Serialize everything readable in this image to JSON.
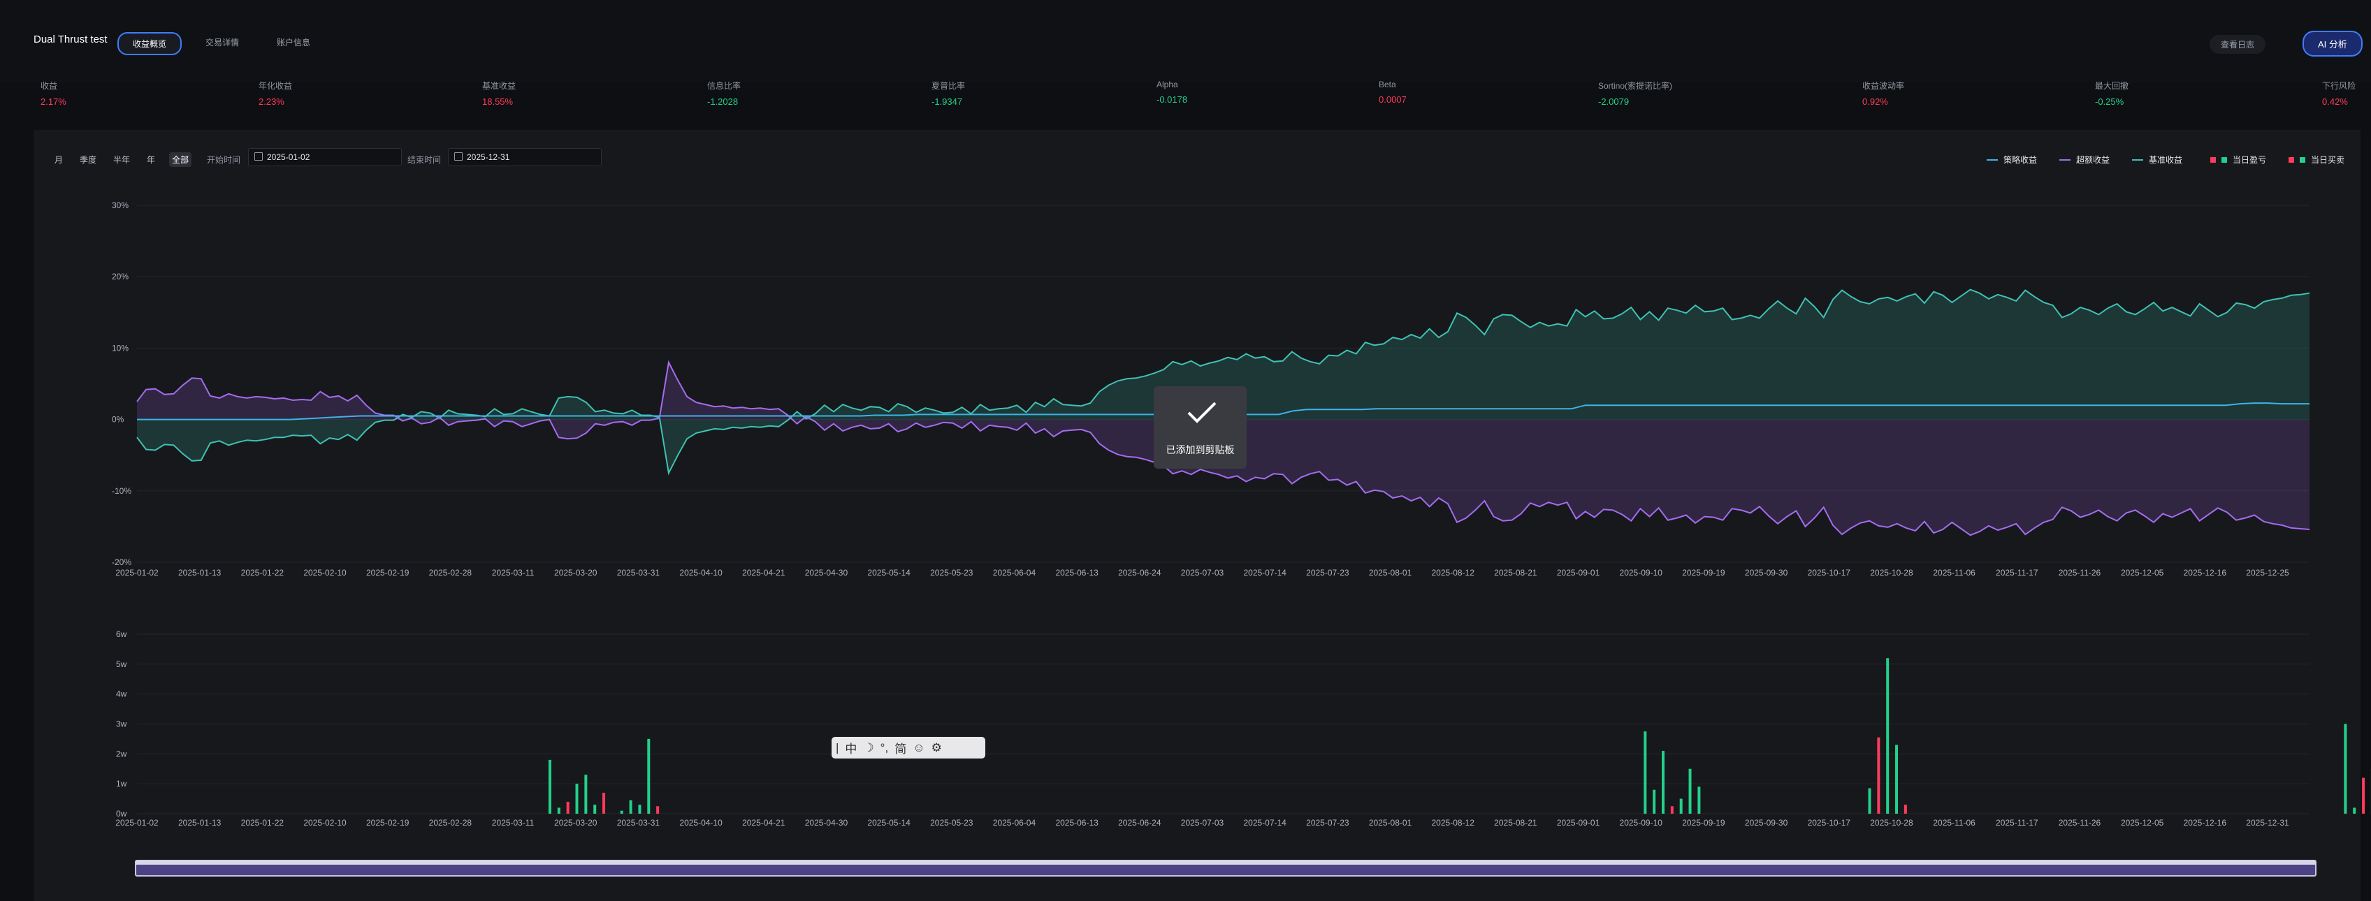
{
  "app_title": "Dual Thrust test",
  "tabs": [
    {
      "label": "收益概览",
      "active": true
    },
    {
      "label": "交易详情",
      "active": false
    },
    {
      "label": "账户信息",
      "active": false
    }
  ],
  "header_buttons": {
    "log": "查看日志",
    "ai": "分析",
    "ai_icon": "AI"
  },
  "metrics": [
    {
      "label": "收益",
      "value": "2.17%",
      "color": "#ff3b5c"
    },
    {
      "label": "年化收益",
      "value": "2.23%",
      "color": "#ff3b5c"
    },
    {
      "label": "基准收益",
      "value": "18.55%",
      "color": "#ff3b5c"
    },
    {
      "label": "信息比率",
      "value": "-1.2028",
      "color": "#23d18b"
    },
    {
      "label": "夏普比率",
      "value": "-1.9347",
      "color": "#23d18b"
    },
    {
      "label": "Alpha",
      "value": "-0.0178",
      "color": "#23d18b"
    },
    {
      "label": "Beta",
      "value": "0.0007",
      "color": "#ff3b5c"
    },
    {
      "label": "Sortino(索提诺比率)",
      "value": "-2.0079",
      "color": "#23d18b"
    },
    {
      "label": "收益波动率",
      "value": "0.92%",
      "color": "#ff3b5c"
    },
    {
      "label": "最大回撤",
      "value": "-0.25%",
      "color": "#23d18b"
    },
    {
      "label": "下行风险",
      "value": "0.42%",
      "color": "#ff3b5c"
    }
  ],
  "periods": [
    {
      "label": "月",
      "active": false
    },
    {
      "label": "季度",
      "active": false
    },
    {
      "label": "半年",
      "active": false
    },
    {
      "label": "年",
      "active": false
    },
    {
      "label": "全部",
      "active": true
    }
  ],
  "date_range": {
    "start_label": "开始时间",
    "start": "2025-01-02",
    "end_label": "结束时间",
    "end": "2025-12-31"
  },
  "legend": [
    {
      "label": "策略收益",
      "kind": "line",
      "color": "#3db4e6"
    },
    {
      "label": "超额收益",
      "kind": "line",
      "color": "#a56cf0"
    },
    {
      "label": "基准收益",
      "kind": "line",
      "color": "#3ec2b3"
    },
    {
      "label": "当日盈亏",
      "kind": "square",
      "color": "#ff3b5c",
      "color2": "#23d18b"
    },
    {
      "label": "当日买卖",
      "kind": "square",
      "color": "#ff3b5c",
      "color2": "#23d18b"
    }
  ],
  "toast": {
    "text": "已添加到剪贴板",
    "icon": "check-icon"
  },
  "ime": [
    "|",
    "中",
    "☽",
    "°,",
    "简",
    "☺",
    "⚙"
  ],
  "chart_data": [
    {
      "type": "area",
      "x_ticks": [
        "2025-01-02",
        "2025-01-13",
        "2025-01-22",
        "2025-02-10",
        "2025-02-19",
        "2025-02-28",
        "2025-03-11",
        "2025-03-20",
        "2025-03-31",
        "2025-04-10",
        "2025-04-21",
        "2025-04-30",
        "2025-05-14",
        "2025-05-23",
        "2025-06-04",
        "2025-06-13",
        "2025-06-24",
        "2025-07-03",
        "2025-07-14",
        "2025-07-23",
        "2025-08-01",
        "2025-08-12",
        "2025-08-21",
        "2025-09-01",
        "2025-09-10",
        "2025-09-19",
        "2025-09-30",
        "2025-10-17",
        "2025-10-28",
        "2025-11-06",
        "2025-11-17",
        "2025-11-26",
        "2025-12-05",
        "2025-12-16",
        "2025-12-25"
      ],
      "y_ticks": [
        "30%",
        "20%",
        "10%",
        "0%",
        "-10%",
        "-20%"
      ],
      "ylim": [
        -20,
        30
      ],
      "series": [
        {
          "name": "策略收益",
          "color": "#3db4e6",
          "values": [
            0,
            0,
            0,
            0,
            0,
            0,
            0,
            0,
            0,
            0,
            0,
            0,
            0.1,
            0.2,
            0.3,
            0.4,
            0.5,
            0.5,
            0.5,
            0.5,
            0.5,
            0.5,
            0.5,
            0.5,
            0.5,
            0.5,
            0.5,
            0.5,
            0.5,
            0.5,
            0.5,
            0.5,
            0.5,
            0.5,
            0.5,
            0.5,
            0.5,
            0.5,
            0.5,
            0.5,
            0.5,
            0.5,
            0.5,
            0.5,
            0.5,
            0.5,
            0.5,
            0.5,
            0.5,
            0.5,
            0.5,
            0.5,
            0.5,
            0.6,
            0.6,
            0.6,
            0.7,
            0.7,
            0.7,
            0.7,
            0.7,
            0.7,
            0.7,
            0.7,
            0.7,
            0.7,
            0.7,
            0.7,
            0.7,
            0.7,
            0.7,
            0.7,
            0.7,
            0.7,
            0.7,
            0.7,
            0.7,
            0.7,
            0.7,
            0.7,
            0.7,
            0.7,
            0.7,
            1.2,
            1.4,
            1.4,
            1.4,
            1.4,
            1.4,
            1.5,
            1.5,
            1.5,
            1.5,
            1.5,
            1.5,
            1.5,
            1.5,
            1.5,
            1.5,
            1.5,
            1.5,
            1.5,
            1.5,
            1.5,
            2.0,
            2.0,
            2.0,
            2.0,
            2.0,
            2.0,
            2.0,
            2.0,
            2.0,
            2.0,
            2.0,
            2.0,
            2.0,
            2.0,
            2.0,
            2.0,
            2.0,
            2.0,
            2.0,
            2.0,
            2.0,
            2.0,
            2.0,
            2.0,
            2.0,
            2.0,
            2.0,
            2.0,
            2.0,
            2.0,
            2.0,
            2.0,
            2.0,
            2.0,
            2.0,
            2.0,
            2.0,
            2.0,
            2.0,
            2.0,
            2.0,
            2.0,
            2.0,
            2.0,
            2.0,
            2.0,
            2.0,
            2.2,
            2.3,
            2.3,
            2.2,
            2.2,
            2.2
          ]
        },
        {
          "name": "超额收益",
          "color": "#a56cf0",
          "values": [
            2.5,
            4.2,
            4.3,
            3.5,
            3.6,
            4.8,
            5.8,
            5.7,
            3.3,
            3.0,
            3.6,
            3.2,
            3.0,
            3.2,
            3.1,
            2.9,
            3.0,
            2.7,
            2.8,
            2.7,
            3.9,
            3.1,
            3.3,
            2.6,
            3.4,
            2.0,
            0.9,
            0.6,
            0.6,
            -0.2,
            0.2,
            -0.6,
            -0.4,
            0.3,
            -0.8,
            -0.3,
            -0.2,
            -0.1,
            0.1,
            -1.0,
            -0.2,
            -0.3,
            -1.0,
            -0.6,
            -0.2,
            0.0,
            -2.5,
            -2.7,
            -2.6,
            -1.9,
            -0.6,
            -0.8,
            -0.4,
            -0.3,
            -0.8,
            -0.1,
            -0.1,
            0.2,
            8.0,
            5.5,
            3.2,
            2.4,
            2.1,
            1.8,
            1.9,
            1.6,
            1.7,
            1.5,
            1.6,
            1.4,
            1.5,
            0.6,
            -0.6,
            0.4,
            -0.3,
            -1.5,
            -0.6,
            -1.6,
            -1.1,
            -0.8,
            -1.3,
            -1.2,
            -0.6,
            -1.7,
            -1.3,
            -0.5,
            -1.1,
            -0.8,
            -0.4,
            -0.5,
            -1.2,
            -0.3,
            -1.6,
            -0.8,
            -1.0,
            -1.1,
            -1.5,
            -0.5,
            -1.9,
            -1.3,
            -2.4,
            -1.6,
            -1.5,
            -1.4,
            -1.8,
            -3.4,
            -4.3,
            -4.9,
            -5.2,
            -5.3,
            -5.6,
            -6.0,
            -6.5,
            -7.6,
            -7.2,
            -7.7,
            -7.0,
            -7.4,
            -7.7,
            -8.2,
            -7.9,
            -8.7,
            -8.1,
            -8.3,
            -7.6,
            -7.7,
            -9.0,
            -8.1,
            -7.6,
            -7.3,
            -8.5,
            -8.4,
            -9.2,
            -8.7,
            -10.3,
            -9.9,
            -10.1,
            -11.0,
            -10.7,
            -11.4,
            -10.9,
            -12.2,
            -11.0,
            -11.8,
            -14.4,
            -13.8,
            -12.7,
            -11.4,
            -13.6,
            -14.2,
            -14.1,
            -13.2,
            -11.7,
            -12.2,
            -11.6,
            -12.0,
            -11.6,
            -13.9,
            -12.9,
            -13.7,
            -12.6,
            -12.7,
            -13.3,
            -14.2,
            -12.5,
            -13.6,
            -12.4,
            -14.1,
            -13.8,
            -13.4,
            -14.5,
            -13.6,
            -13.7,
            -14.1,
            -12.5,
            -12.7,
            -13.1,
            -12.2,
            -13.5,
            -14.6,
            -13.6,
            -12.8,
            -15.0,
            -13.8,
            -12.3,
            -14.8,
            -16.1,
            -15.2,
            -14.5,
            -14.2,
            -14.9,
            -15.1,
            -14.6,
            -15.2,
            -15.6,
            -14.3,
            -15.9,
            -15.4,
            -14.4,
            -15.3,
            -16.2,
            -15.7,
            -14.9,
            -15.5,
            -15.1,
            -14.6,
            -16.1,
            -15.2,
            -14.4,
            -14.0,
            -12.3,
            -12.8,
            -13.7,
            -13.3,
            -12.7,
            -13.6,
            -14.2,
            -13.1,
            -12.7,
            -13.5,
            -14.4,
            -13.2,
            -13.7,
            -13.1,
            -12.5,
            -14.2,
            -13.3,
            -12.4,
            -13.0,
            -14.1,
            -13.8,
            -13.4,
            -14.3,
            -14.6,
            -14.8,
            -15.2,
            -15.3,
            -15.4
          ]
        },
        {
          "name": "基准收益",
          "color": "#3ec2b3",
          "values": [
            -2.5,
            -4.2,
            -4.3,
            -3.5,
            -3.6,
            -4.8,
            -5.8,
            -5.7,
            -3.3,
            -3.0,
            -3.6,
            -3.2,
            -2.9,
            -3.0,
            -2.8,
            -2.5,
            -2.5,
            -2.2,
            -2.3,
            -2.2,
            -3.4,
            -2.6,
            -2.8,
            -2.1,
            -2.9,
            -1.5,
            -0.4,
            -0.1,
            -0.1,
            0.7,
            0.3,
            1.1,
            0.9,
            0.2,
            1.3,
            0.8,
            0.7,
            0.6,
            0.4,
            1.5,
            0.7,
            0.8,
            1.5,
            1.1,
            0.7,
            0.5,
            3.0,
            3.2,
            3.1,
            2.4,
            1.1,
            1.3,
            0.9,
            0.8,
            1.3,
            0.6,
            0.6,
            0.3,
            -7.5,
            -5.0,
            -2.7,
            -1.9,
            -1.6,
            -1.3,
            -1.4,
            -1.1,
            -1.2,
            -1.0,
            -1.1,
            -0.9,
            -1.0,
            -0.1,
            1.1,
            0.1,
            0.8,
            2.0,
            1.1,
            2.1,
            1.6,
            1.3,
            1.8,
            1.7,
            1.1,
            2.2,
            1.8,
            1.0,
            1.6,
            1.3,
            0.9,
            1.0,
            1.7,
            0.8,
            2.1,
            1.3,
            1.5,
            1.6,
            2.0,
            1.0,
            2.4,
            1.8,
            2.9,
            2.1,
            2.0,
            1.9,
            2.3,
            3.9,
            4.8,
            5.4,
            5.7,
            5.8,
            6.1,
            6.5,
            7.0,
            8.1,
            7.7,
            8.2,
            7.5,
            7.9,
            8.2,
            8.7,
            8.4,
            9.2,
            8.6,
            8.8,
            8.1,
            8.2,
            9.5,
            8.6,
            8.1,
            7.8,
            9.0,
            8.9,
            9.7,
            9.2,
            10.8,
            10.4,
            10.6,
            11.5,
            11.2,
            11.9,
            11.4,
            12.7,
            11.5,
            12.3,
            14.9,
            14.3,
            13.2,
            11.9,
            14.1,
            14.7,
            14.6,
            13.7,
            12.9,
            13.6,
            13.1,
            13.4,
            13.1,
            15.4,
            14.4,
            15.2,
            14.1,
            14.2,
            14.8,
            15.7,
            14.0,
            15.1,
            13.9,
            15.6,
            15.3,
            14.9,
            16.0,
            15.1,
            15.2,
            15.6,
            14.0,
            14.2,
            14.6,
            14.2,
            15.5,
            16.6,
            15.6,
            14.8,
            17.0,
            15.8,
            14.3,
            16.8,
            18.1,
            17.2,
            16.5,
            16.2,
            16.9,
            17.1,
            16.6,
            17.2,
            17.6,
            16.3,
            17.9,
            17.4,
            16.4,
            17.3,
            18.2,
            17.7,
            16.9,
            17.5,
            17.1,
            16.6,
            18.1,
            17.2,
            16.4,
            16.0,
            14.3,
            14.8,
            15.7,
            15.3,
            14.7,
            15.6,
            16.2,
            15.1,
            14.7,
            15.5,
            16.4,
            15.2,
            15.7,
            15.1,
            14.5,
            16.2,
            15.3,
            14.4,
            15.0,
            16.3,
            16.1,
            15.6,
            16.5,
            16.8,
            17.0,
            17.4,
            17.5,
            17.7
          ]
        }
      ]
    },
    {
      "type": "bar",
      "x_ticks": [
        "2025-01-02",
        "2025-01-13",
        "2025-01-22",
        "2025-02-10",
        "2025-02-19",
        "2025-02-28",
        "2025-03-11",
        "2025-03-20",
        "2025-03-31",
        "2025-04-10",
        "2025-04-21",
        "2025-04-30",
        "2025-05-14",
        "2025-05-23",
        "2025-06-04",
        "2025-06-13",
        "2025-06-24",
        "2025-07-03",
        "2025-07-14",
        "2025-07-23",
        "2025-08-01",
        "2025-08-12",
        "2025-08-21",
        "2025-09-01",
        "2025-09-10",
        "2025-09-19",
        "2025-09-30",
        "2025-10-17",
        "2025-10-28",
        "2025-11-06",
        "2025-11-17",
        "2025-11-26",
        "2025-12-05",
        "2025-12-16",
        "2025-12-31"
      ],
      "y_ticks": [
        "6w",
        "5w",
        "4w",
        "3w",
        "2w",
        "1w",
        "0w"
      ],
      "ylim": [
        0,
        60000
      ],
      "bars": [
        {
          "idx": 46,
          "value": 18000,
          "color": "#23d18b"
        },
        {
          "idx": 47,
          "value": 2000,
          "color": "#23d18b"
        },
        {
          "idx": 48,
          "value": 4000,
          "color": "#ff3b5c"
        },
        {
          "idx": 49,
          "value": 10000,
          "color": "#23d18b"
        },
        {
          "idx": 50,
          "value": 13000,
          "color": "#23d18b"
        },
        {
          "idx": 51,
          "value": 3000,
          "color": "#23d18b"
        },
        {
          "idx": 52,
          "value": 7000,
          "color": "#ff3b5c"
        },
        {
          "idx": 54,
          "value": 1000,
          "color": "#23d18b"
        },
        {
          "idx": 55,
          "value": 4500,
          "color": "#23d18b"
        },
        {
          "idx": 56,
          "value": 3000,
          "color": "#23d18b"
        },
        {
          "idx": 57,
          "value": 25000,
          "color": "#23d18b"
        },
        {
          "idx": 58,
          "value": 2500,
          "color": "#ff3b5c"
        },
        {
          "idx": 168,
          "value": 27500,
          "color": "#23d18b"
        },
        {
          "idx": 169,
          "value": 8000,
          "color": "#23d18b"
        },
        {
          "idx": 170,
          "value": 21000,
          "color": "#23d18b"
        },
        {
          "idx": 171,
          "value": 2500,
          "color": "#ff3b5c"
        },
        {
          "idx": 172,
          "value": 5000,
          "color": "#23d18b"
        },
        {
          "idx": 173,
          "value": 15000,
          "color": "#23d18b"
        },
        {
          "idx": 174,
          "value": 9000,
          "color": "#23d18b"
        },
        {
          "idx": 193,
          "value": 8500,
          "color": "#23d18b"
        },
        {
          "idx": 194,
          "value": 25500,
          "color": "#ff3b5c"
        },
        {
          "idx": 195,
          "value": 52000,
          "color": "#23d18b"
        },
        {
          "idx": 196,
          "value": 23000,
          "color": "#23d18b"
        },
        {
          "idx": 197,
          "value": 3000,
          "color": "#ff3b5c"
        },
        {
          "idx": 246,
          "value": 30000,
          "color": "#23d18b"
        },
        {
          "idx": 247,
          "value": 2000,
          "color": "#23d18b"
        },
        {
          "idx": 248,
          "value": 12000,
          "color": "#ff3b5c"
        },
        {
          "idx": 249,
          "value": 15000,
          "color": "#23d18b"
        },
        {
          "idx": 250,
          "value": 18000,
          "color": "#ff3b5c"
        },
        {
          "idx": 251,
          "value": 5000,
          "color": "#ff3b5c"
        }
      ],
      "n_points": 243
    }
  ]
}
